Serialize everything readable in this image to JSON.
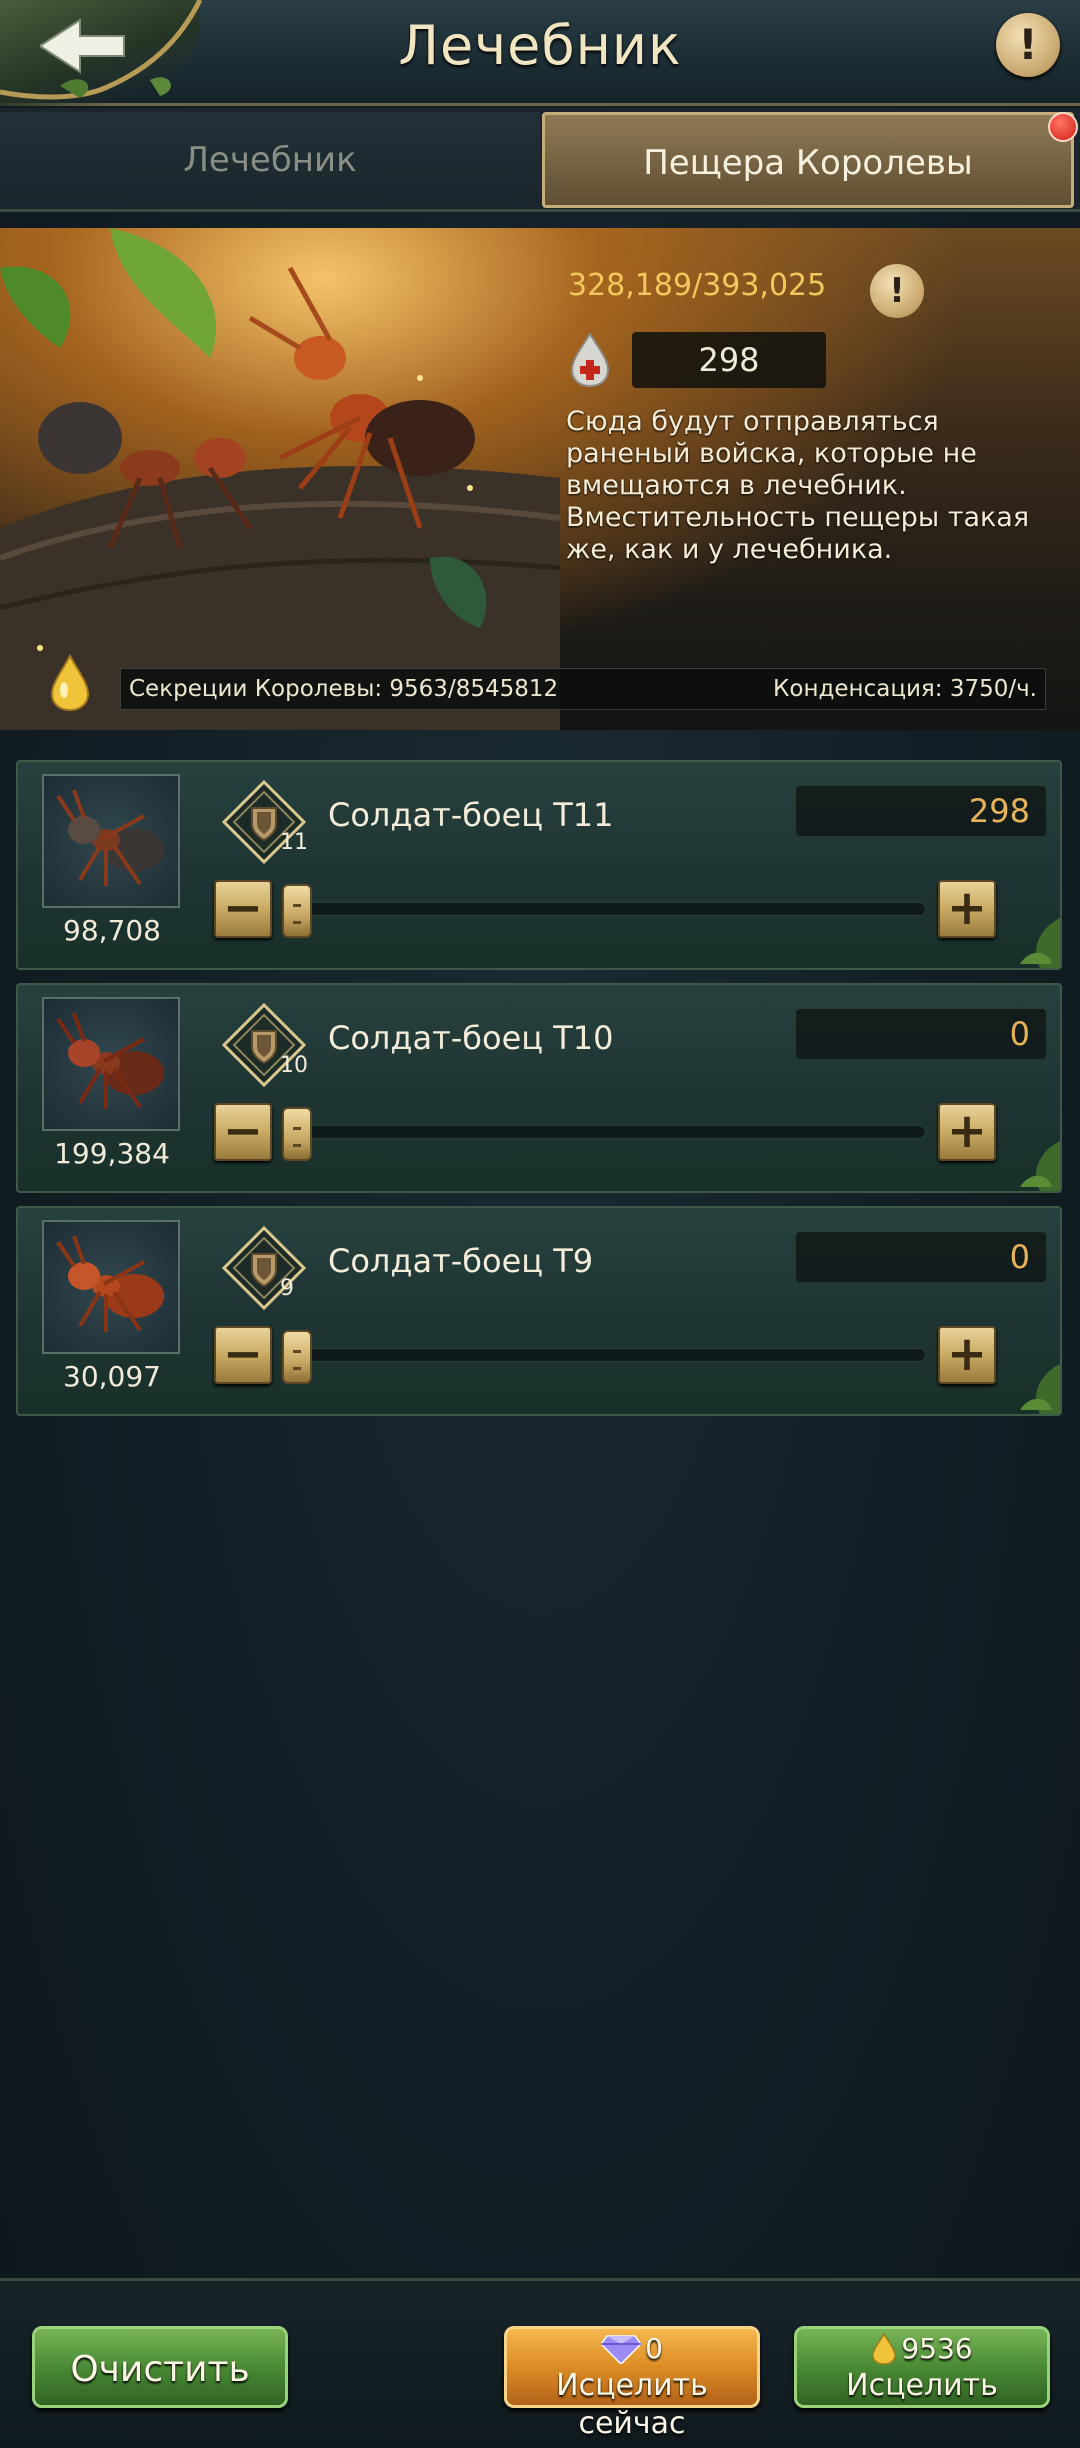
{
  "header": {
    "title": "Лечебник",
    "back_icon": "back-arrow-icon",
    "info_icon": "info-icon"
  },
  "tabs": [
    {
      "label": "Лечебник",
      "active": false
    },
    {
      "label": "Пещера Королевы",
      "active": true,
      "notification_dot": true
    }
  ],
  "banner": {
    "capacity": "328,189/393,025",
    "wounded": "298",
    "description": "Сюда будут отправляться раненый войска, которые не вмещаются в лечебник. Вместительность пещеры такая же, как и у лечебника.",
    "secretion": "Секреции Королевы: 9563/8545812",
    "condensation": "Конденсация: 3750/ч."
  },
  "troops": [
    {
      "name": "Солдат-боец T11",
      "tier": "11",
      "count": "98,708",
      "quantity": "298",
      "quantity_color": "#e8b25a",
      "slider_fraction": 0
    },
    {
      "name": "Солдат-боец T10",
      "tier": "10",
      "count": "199,384",
      "quantity": "0",
      "quantity_color": "#e8b25a",
      "slider_fraction": 0
    },
    {
      "name": "Солдат-боец T9",
      "tier": "9",
      "count": "30,097",
      "quantity": "0",
      "quantity_color": "#e8b25a",
      "slider_fraction": 0
    }
  ],
  "footer": {
    "clear_label": "Очистить",
    "heal_now_cost": "0",
    "heal_now_label": "Исцелить сейчас",
    "heal_cost": "9536",
    "heal_label": "Исцелить"
  },
  "colors": {
    "accent_gold": "#f2c85c",
    "green_button": "#4a8a35",
    "orange_button": "#dc8d24"
  }
}
